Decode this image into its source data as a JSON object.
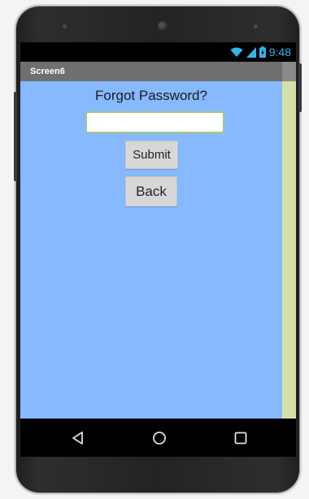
{
  "status_bar": {
    "time": "9:48",
    "icons": [
      "wifi-icon",
      "signal-icon",
      "battery-icon"
    ]
  },
  "title_bar": {
    "title": "Screen6"
  },
  "form": {
    "heading": "Forgot Password?",
    "email_value": "",
    "submit_label": "Submit",
    "back_label": "Back"
  },
  "nav_bar": {
    "icons": [
      "back-triangle-icon",
      "home-circle-icon",
      "recents-square-icon"
    ]
  },
  "colors": {
    "content_bg": "#86b9ff",
    "scrollbar": "#d3e1a9",
    "title_bar": "#6f6f6f",
    "status_accent": "#31b4ea",
    "button_bg": "#d7d7d7"
  }
}
